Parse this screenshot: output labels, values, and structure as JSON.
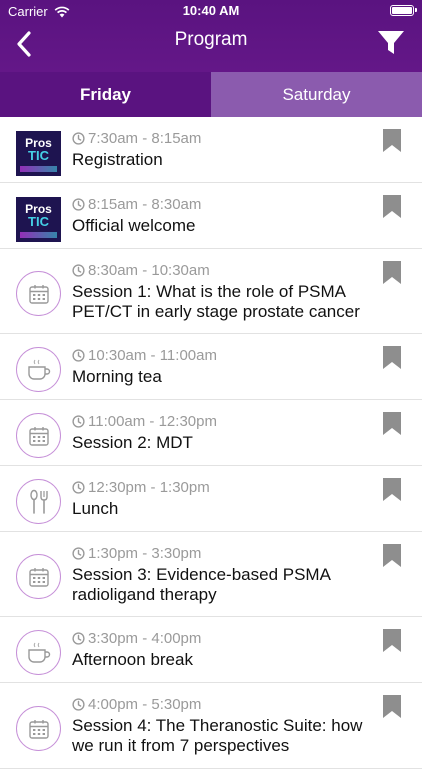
{
  "status_bar": {
    "carrier": "Carrier",
    "time": "10:40 AM"
  },
  "nav": {
    "title": "Program"
  },
  "tabs": [
    {
      "label": "Friday",
      "active": true
    },
    {
      "label": "Saturday",
      "active": false
    }
  ],
  "sessions": [
    {
      "time": "7:30am - 8:15am",
      "title": "Registration",
      "icon": "prostic-logo"
    },
    {
      "time": "8:15am - 8:30am",
      "title": "Official welcome",
      "icon": "prostic-logo"
    },
    {
      "time": "8:30am - 10:30am",
      "title": "Session 1: What is the role of PSMA PET/CT in early stage prostate cancer",
      "icon": "calendar-icon"
    },
    {
      "time": "10:30am - 11:00am",
      "title": "Morning tea",
      "icon": "coffee-cup-icon"
    },
    {
      "time": "11:00am - 12:30pm",
      "title": "Session 2: MDT",
      "icon": "calendar-icon"
    },
    {
      "time": "12:30pm - 1:30pm",
      "title": "Lunch",
      "icon": "utensils-icon"
    },
    {
      "time": "1:30pm - 3:30pm",
      "title": "Session 3: Evidence-based PSMA radioligand therapy",
      "icon": "calendar-icon"
    },
    {
      "time": "3:30pm - 4:00pm",
      "title": "Afternoon break",
      "icon": "coffee-cup-icon"
    },
    {
      "time": "4:00pm - 5:30pm",
      "title": "Session 4: The Theranostic Suite: how we run it from 7 perspectives",
      "icon": "calendar-icon"
    }
  ],
  "logo": {
    "line1": "Pros",
    "line2": "TIC"
  },
  "colors": {
    "header": "#5a1380",
    "tab_inactive": "#8b5bae",
    "icon_ring": "#c690d8",
    "bookmark": "#8e8e8e"
  }
}
